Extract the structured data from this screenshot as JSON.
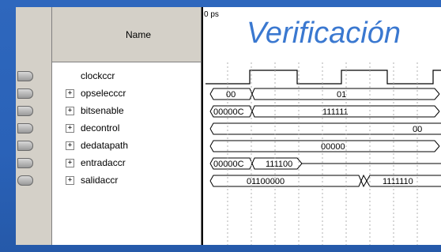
{
  "slide": {
    "title": "Verificación"
  },
  "waveform": {
    "name_header": "Name",
    "time_marker": "0 ps",
    "signals": [
      {
        "name": "clockccr",
        "kind": "clock",
        "expandable": false,
        "values": []
      },
      {
        "name": "opseleccc r",
        "kind": "bus",
        "expandable": true,
        "values": [
          "00",
          "01"
        ]
      },
      {
        "name": "bitsenable",
        "kind": "bus",
        "expandable": true,
        "values": [
          "00000C",
          "111111"
        ]
      },
      {
        "name": "decontrol",
        "kind": "bus",
        "expandable": true,
        "values": [
          "00"
        ]
      },
      {
        "name": "dedatapath",
        "kind": "bus",
        "expandable": true,
        "values": [
          "00000"
        ]
      },
      {
        "name": "entradaccr",
        "kind": "bus",
        "expandable": true,
        "values": [
          "00000C",
          "111100"
        ]
      },
      {
        "name": "salidaccr",
        "kind": "bus",
        "expandable": true,
        "values": [
          "01100000",
          "1111110"
        ]
      }
    ]
  }
}
